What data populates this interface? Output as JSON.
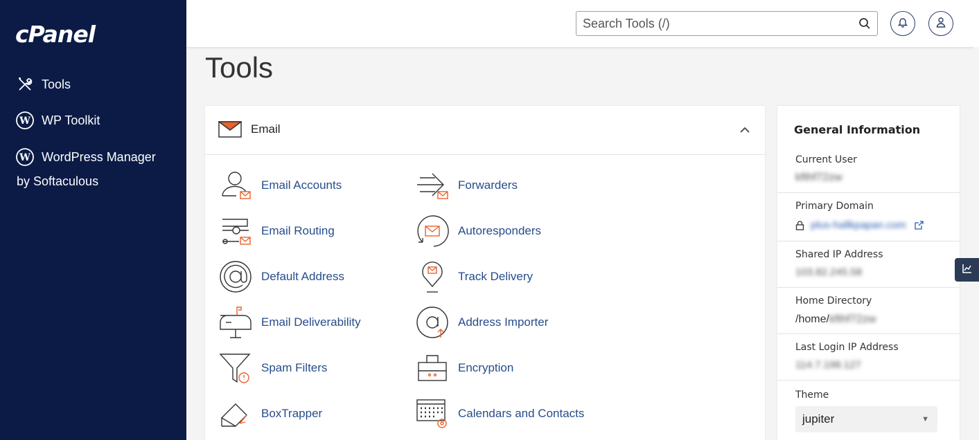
{
  "sidebar": {
    "logo": "cPanel",
    "items": [
      {
        "label": "Tools",
        "icon": "tools-icon"
      },
      {
        "label": "WP Toolkit",
        "icon": "wordpress-icon"
      },
      {
        "label": "WordPress Manager",
        "icon": "wordpress-icon"
      }
    ],
    "wp_manager_sub": "by Softaculous"
  },
  "header": {
    "search_placeholder": "Search Tools (/)",
    "notifications_icon": "bell-icon",
    "user_icon": "user-icon"
  },
  "page": {
    "title": "Tools"
  },
  "email_panel": {
    "title": "Email",
    "icon": "envelope-icon",
    "tools": [
      {
        "label": "Email Accounts",
        "icon": "email-accounts-icon"
      },
      {
        "label": "Forwarders",
        "icon": "forwarders-icon"
      },
      {
        "label": "Email Routing",
        "icon": "email-routing-icon"
      },
      {
        "label": "Autoresponders",
        "icon": "autoresponders-icon"
      },
      {
        "label": "Default Address",
        "icon": "at-sign-icon"
      },
      {
        "label": "Track Delivery",
        "icon": "track-delivery-icon"
      },
      {
        "label": "Email Deliverability",
        "icon": "mailbox-icon"
      },
      {
        "label": "Address Importer",
        "icon": "address-importer-icon"
      },
      {
        "label": "Spam Filters",
        "icon": "funnel-icon"
      },
      {
        "label": "Encryption",
        "icon": "briefcase-lock-icon"
      },
      {
        "label": "BoxTrapper",
        "icon": "boxtrapper-icon"
      },
      {
        "label": "Calendars and Contacts",
        "icon": "calendar-icon"
      }
    ]
  },
  "general_info": {
    "title": "General Information",
    "current_user_label": "Current User",
    "current_user_value": "kfthf72zw",
    "primary_domain_label": "Primary Domain",
    "primary_domain_value": "plus-hallkpapan.com",
    "shared_ip_label": "Shared IP Address",
    "shared_ip_value": "103.82.245.58",
    "home_dir_label": "Home Directory",
    "home_dir_prefix": "/home/",
    "home_dir_user": "kfthf72zw",
    "last_login_label": "Last Login IP Address",
    "last_login_value": "114.7.198.127",
    "theme_label": "Theme",
    "theme_value": "jupiter"
  },
  "colors": {
    "sidebar_bg": "#0b1b46",
    "link": "#264d8c",
    "accent_orange": "#e8622c"
  }
}
